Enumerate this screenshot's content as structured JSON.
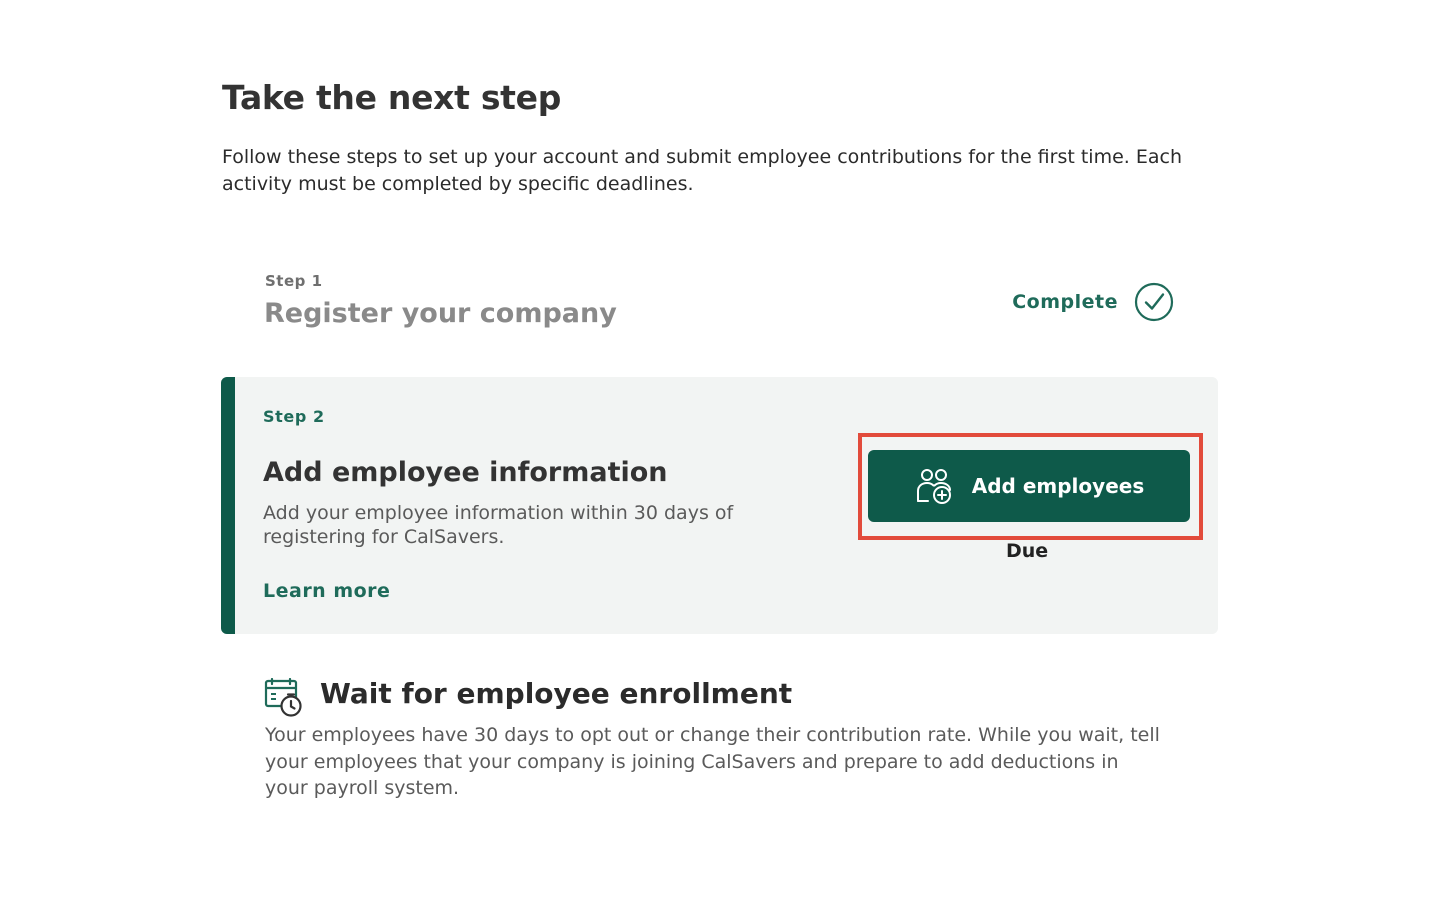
{
  "header": {
    "title": "Take the next step",
    "intro": "Follow these steps to set up your account and submit employee contributions for the first time. Each activity must be completed by specific deadlines."
  },
  "steps": {
    "step1": {
      "label": "Step 1",
      "title": "Register your company",
      "status": "Complete",
      "status_icon": "check-circle-icon"
    },
    "step2": {
      "label": "Step 2",
      "title": "Add employee information",
      "description": "Add your employee information within 30 days of registering for CalSavers.",
      "learn_more": "Learn more",
      "button_label": "Add employees",
      "button_icon": "add-people-icon",
      "due_label": "Due"
    },
    "step3": {
      "title": "Wait for employee enrollment",
      "icon": "calendar-clock-icon",
      "description": "Your employees have 30 days to opt out or change their contribution rate. While you wait, tell your employees that your company is joining CalSavers and prepare to add deductions in your payroll system."
    }
  },
  "colors": {
    "brand_green": "#0e5a4a",
    "accent_green": "#1f6b5a",
    "highlight_red": "#e24b3b",
    "card_bg": "#f2f4f3"
  }
}
